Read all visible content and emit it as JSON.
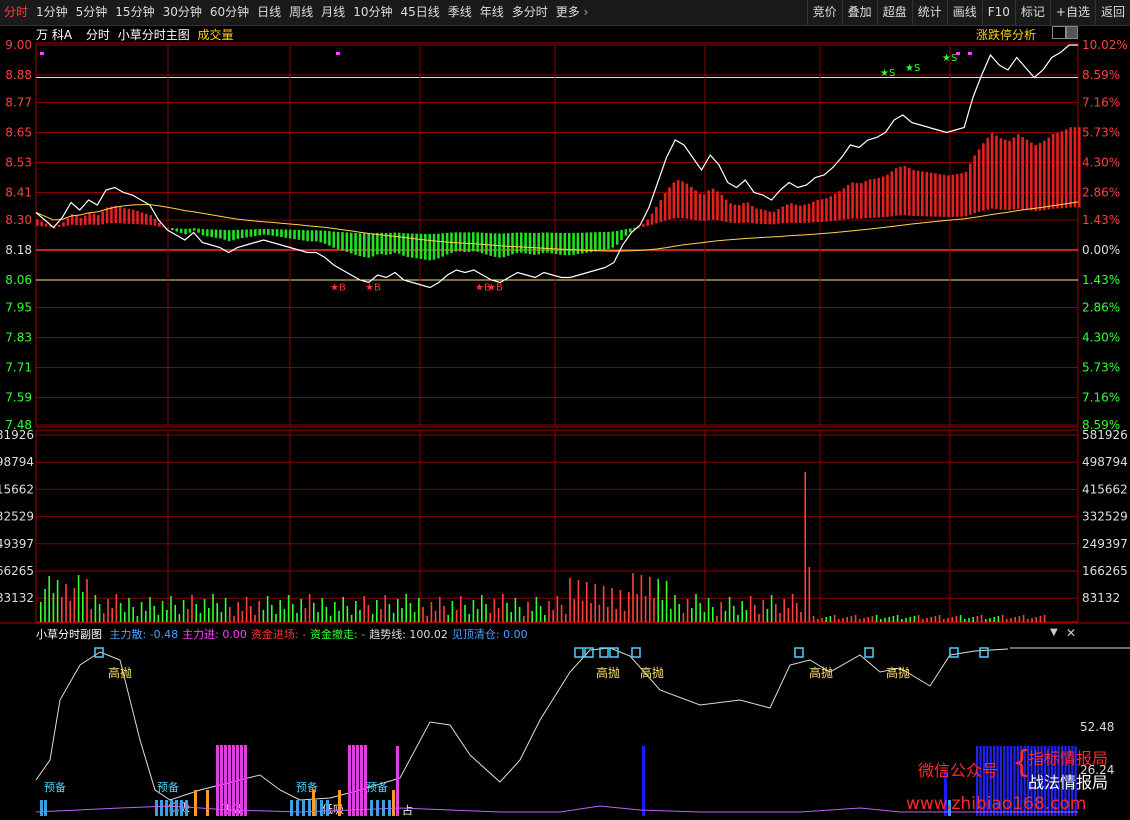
{
  "toolbar": {
    "tabs": [
      "分时",
      "1分钟",
      "5分钟",
      "15分钟",
      "30分钟",
      "60分钟",
      "日线",
      "周线",
      "月线",
      "10分钟",
      "45日线",
      "季线",
      "年线",
      "多分时",
      "更多"
    ],
    "active_index": 0,
    "right_buttons": [
      "竞价",
      "叠加",
      "超盘",
      "统计",
      "画线",
      "F10",
      "标记",
      "+自选",
      "返回"
    ]
  },
  "main": {
    "stock_name": "万 科A",
    "mode_label": "分时",
    "indicator_label": "小草分时主图",
    "volume_label": "成交量",
    "limit_analysis": "涨跌停分析",
    "price_ticks": [
      "9.00",
      "8.88",
      "8.77",
      "8.65",
      "8.53",
      "8.41",
      "8.30",
      "8.18",
      "8.06",
      "7.95",
      "7.83",
      "7.71",
      "7.59",
      "7.48"
    ],
    "pct_ticks": [
      "10.02%",
      "8.59%",
      "7.16%",
      "5.73%",
      "4.30%",
      "2.86%",
      "1.43%",
      "0.00%",
      "1.43%",
      "2.86%",
      "4.30%",
      "5.73%",
      "7.16%",
      "8.59%"
    ],
    "star_labels": [
      "B",
      "B",
      "B",
      "B",
      "S",
      "S",
      "S"
    ]
  },
  "volume": {
    "ticks": [
      "581926",
      "498794",
      "415662",
      "332529",
      "249397",
      "166265",
      "83132"
    ]
  },
  "sub": {
    "title": "小草分时副图",
    "items": [
      {
        "label": "主力散:",
        "value": "-0.48",
        "color": "#4aa3ff"
      },
      {
        "label": "主力进:",
        "value": "0.00",
        "color": "#ff40ff"
      },
      {
        "label": "资金进场:",
        "value": "-",
        "color": "#ff3030"
      },
      {
        "label": "资金撤走:",
        "value": "-",
        "color": "#30ff30"
      },
      {
        "label": "趋势线:",
        "value": "100.02",
        "color": "#dddddd"
      },
      {
        "label": "见顶清仓:",
        "value": "0.00",
        "color": "#4aa3ff"
      }
    ],
    "right_ticks": [
      "52.48",
      "26.24"
    ],
    "annotations": {
      "high_throw": "高抛",
      "prepare": "预备",
      "absorb": "低吸",
      "bottom": "底",
      "occupy": "占"
    }
  },
  "watermark": {
    "line1_left": "微信公众号",
    "line1_right": "指标情报局",
    "line2_right": "战法情报局",
    "url": "www.zhibiao168.com"
  },
  "chart_data": {
    "type": "line",
    "title": "",
    "xlabel": "",
    "ylabel": "",
    "ylim": [
      7.48,
      9.0
    ],
    "base_price": 8.18,
    "series": [
      {
        "values": [
          8.33,
          8.3,
          8.27,
          8.31,
          8.37,
          8.34,
          8.38,
          8.36,
          8.42,
          8.43,
          8.41,
          8.4,
          8.38,
          8.36,
          8.3,
          8.26,
          8.24,
          8.22,
          8.25,
          8.21,
          8.2,
          8.19,
          8.17,
          8.19,
          8.2,
          8.21,
          8.22,
          8.21,
          8.2,
          8.19,
          8.18,
          8.17,
          8.17,
          8.15,
          8.12,
          8.1,
          8.08,
          8.06,
          8.05,
          8.08,
          8.07,
          8.09,
          8.06,
          8.05,
          8.04,
          8.03,
          8.05,
          8.08,
          8.1,
          8.09,
          8.1,
          8.08,
          8.06,
          8.05,
          8.07,
          8.09,
          8.08,
          8.07,
          8.09,
          8.08,
          8.07,
          8.07,
          8.08,
          8.09,
          8.1,
          8.11,
          8.13,
          8.2,
          8.25,
          8.28,
          8.35,
          8.45,
          8.55,
          8.62,
          8.6,
          8.55,
          8.5,
          8.56,
          8.52,
          8.45,
          8.43,
          8.46,
          8.41,
          8.4,
          8.38,
          8.42,
          8.45,
          8.43,
          8.44,
          8.47,
          8.48,
          8.51,
          8.55,
          8.6,
          8.59,
          8.62,
          8.63,
          8.65,
          8.7,
          8.72,
          8.69,
          8.68,
          8.67,
          8.66,
          8.65,
          8.66,
          8.67,
          8.79,
          8.88,
          8.96,
          8.92,
          8.9,
          8.95,
          8.91,
          8.87,
          8.9,
          8.95,
          8.97,
          9.0,
          9.0
        ]
      }
    ]
  }
}
